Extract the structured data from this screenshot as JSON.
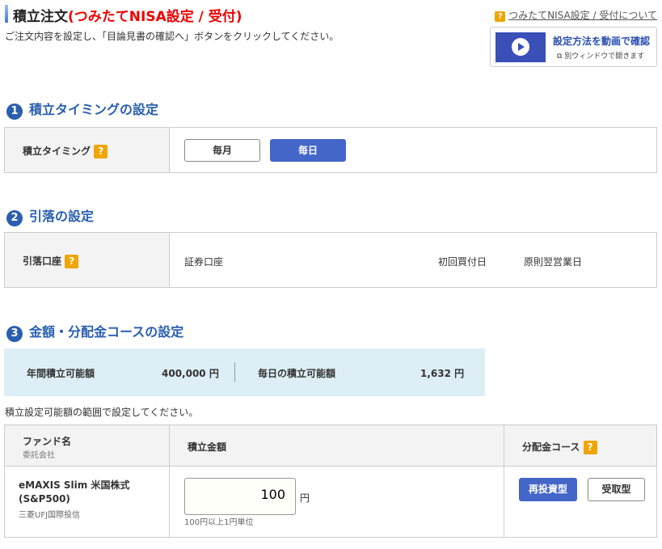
{
  "header": {
    "title": "積立注文",
    "title_sub": "(つみたてNISA設定 / 受付)",
    "help_link": "つみたてNISA設定 / 受付について",
    "instruction": "ご注文内容を設定し、「目論見書の確認へ」ボタンをクリックしてください。",
    "video": {
      "label": "設定方法を動画で確認",
      "sub": "別ウィンドウで開きます"
    }
  },
  "sections": [
    {
      "num": "1",
      "title": "積立タイミングの設定",
      "label": "積立タイミング",
      "options": [
        "毎月",
        "毎日"
      ],
      "selected": "毎日"
    },
    {
      "num": "2",
      "title": "引落の設定",
      "label": "引落口座",
      "account": "証券口座",
      "first_label": "初回買付日",
      "first_value": "原則翌営業日"
    },
    {
      "num": "3",
      "title": "金額・分配金コースの設定",
      "annual_label": "年間積立可能額",
      "annual_value": "400,000 円",
      "daily_label": "毎日の積立可能額",
      "daily_value": "1,632 円",
      "note": "積立設定可能額の範囲で設定してください。",
      "table": {
        "col_fund": "ファンド名",
        "col_fund_sub": "委託会社",
        "col_amount": "積立金額",
        "col_course": "分配金コース",
        "fund_name": "eMAXIS Slim 米国株式 (S&P500)",
        "company": "三菱UFJ国際投信",
        "amount": "100",
        "unit": "円",
        "amount_hint": "100円以上1円単位",
        "courses": [
          "再投資型",
          "受取型"
        ],
        "selected_course": "再投資型"
      }
    }
  ],
  "help_mark": "?"
}
